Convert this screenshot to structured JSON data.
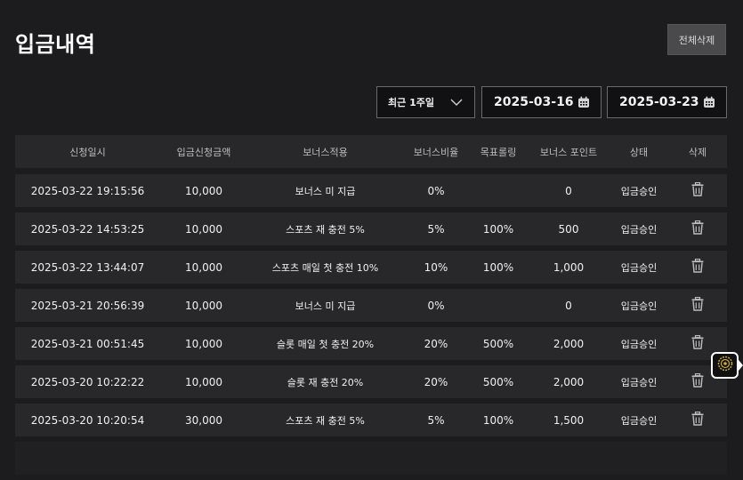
{
  "page": {
    "title": "입금내역",
    "delete_all_label": "전체삭제"
  },
  "filters": {
    "period": "최근 1주일",
    "date_from": "2025-03-16",
    "date_to": "2025-03-23"
  },
  "table": {
    "headers": [
      "신청일시",
      "입금신청금액",
      "보너스적용",
      "보너스비율",
      "목표롤링",
      "보너스 포인트",
      "상태",
      "삭제"
    ],
    "rows": [
      {
        "date": "2025-03-22 19:15:56",
        "amount": "10,000",
        "bonus": "보너스 미 지급",
        "ratio": "0%",
        "rolling": "",
        "points": "0",
        "status": "입금승인"
      },
      {
        "date": "2025-03-22 14:53:25",
        "amount": "10,000",
        "bonus": "스포츠 재 충전 5%",
        "ratio": "5%",
        "rolling": "100%",
        "points": "500",
        "status": "입금승인"
      },
      {
        "date": "2025-03-22 13:44:07",
        "amount": "10,000",
        "bonus": "스포츠 매일 첫 충전 10%",
        "ratio": "10%",
        "rolling": "100%",
        "points": "1,000",
        "status": "입금승인"
      },
      {
        "date": "2025-03-21 20:56:39",
        "amount": "10,000",
        "bonus": "보너스 미 지급",
        "ratio": "0%",
        "rolling": "",
        "points": "0",
        "status": "입금승인"
      },
      {
        "date": "2025-03-21 00:51:45",
        "amount": "10,000",
        "bonus": "슬롯 매일 첫 충전 20%",
        "ratio": "20%",
        "rolling": "500%",
        "points": "2,000",
        "status": "입금승인"
      },
      {
        "date": "2025-03-20 10:22:22",
        "amount": "10,000",
        "bonus": "슬롯 재 충전 20%",
        "ratio": "20%",
        "rolling": "500%",
        "points": "2,000",
        "status": "입금승인"
      },
      {
        "date": "2025-03-20 10:20:54",
        "amount": "30,000",
        "bonus": "스포츠 재 충전 5%",
        "ratio": "5%",
        "rolling": "100%",
        "points": "1,500",
        "status": "입금승인"
      }
    ]
  },
  "icons": {
    "trash": "trash-icon",
    "calendar": "calendar-icon",
    "chevron": "chevron-down-icon",
    "float": "support-icon"
  },
  "colors": {
    "background": "#1c1c1e",
    "row": "#28282a",
    "accent_gold": "#c9a84a"
  }
}
